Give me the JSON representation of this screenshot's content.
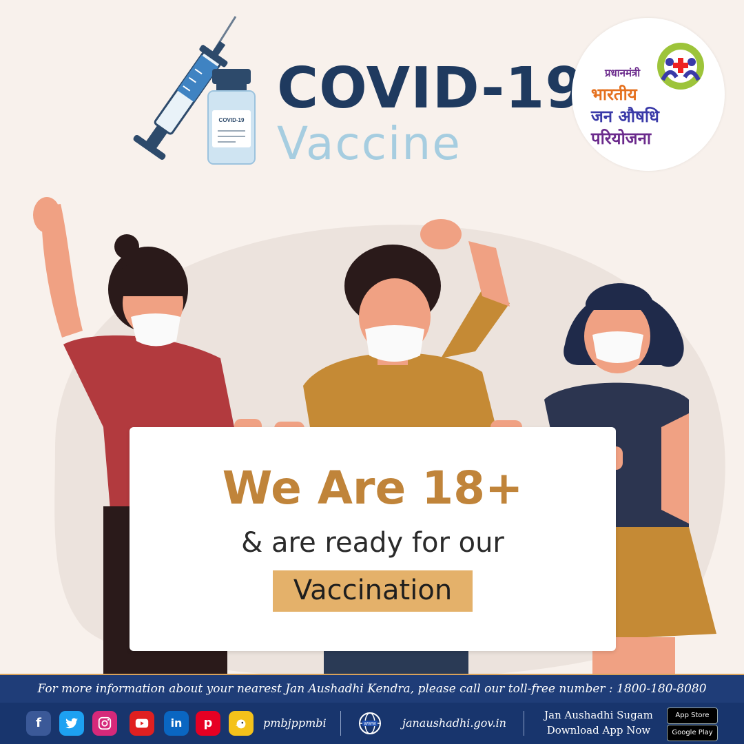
{
  "header": {
    "title": "COVID-19",
    "subtitle": "Vaccine",
    "vial_label": "COVID-19"
  },
  "logo": {
    "line1": "प्रधानमंत्री",
    "line2": "भारतीय",
    "line3": "जन औषधि",
    "line4": "परियोजना"
  },
  "sign": {
    "headline": "We Are 18+",
    "subline": "& are ready for our",
    "badge": "Vaccination"
  },
  "info_bar": {
    "text": "For more information about your nearest Jan Aushadhi Kendra, please call our toll-free number : 1800-180-8080"
  },
  "footer": {
    "social_icons": [
      "facebook-icon",
      "twitter-icon",
      "instagram-icon",
      "youtube-icon",
      "linkedin-icon",
      "pinterest-icon",
      "koo-icon"
    ],
    "handle": "pmbjppmbi",
    "website": "janaushadhi.gov.in",
    "app_name": "Jan Aushadhi Sugam",
    "app_cta": "Download App Now",
    "appstore": "App Store",
    "googleplay": "Google Play"
  },
  "colors": {
    "navy": "#1f3a5f",
    "accent_gold": "#c0843a",
    "badge_bg": "#e4b16a",
    "footer_blue": "#18356d"
  }
}
